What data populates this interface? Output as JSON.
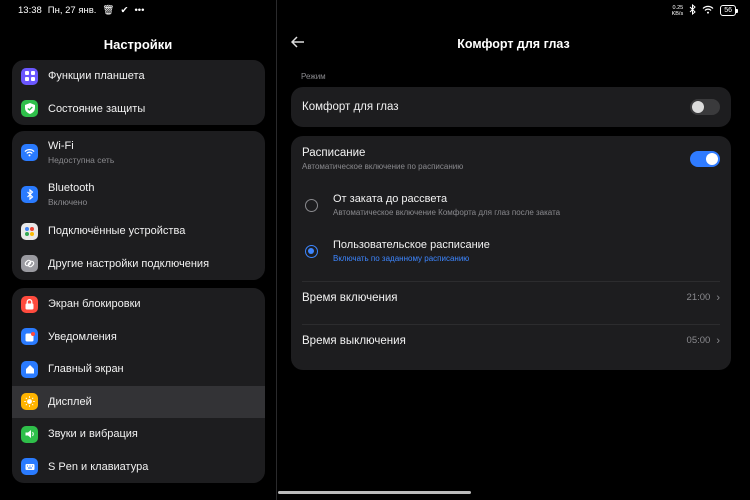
{
  "status_bar": {
    "time": "13:38",
    "date": "Пн, 27 янв.",
    "net_speed": "0.25",
    "net_unit": "KB/s",
    "battery": "56"
  },
  "left": {
    "title": "Настройки",
    "group1": [
      {
        "label": "Функции планшета",
        "icon": "grid-icon",
        "color": "#6b57ff"
      },
      {
        "label": "Состояние защиты",
        "icon": "shield-icon",
        "color": "#2fbf4a"
      }
    ],
    "group2": [
      {
        "label": "Wi-Fi",
        "sub": "Недоступна сеть",
        "icon": "wifi-icon",
        "color": "#2a7bff"
      },
      {
        "label": "Bluetooth",
        "sub": "Включено",
        "icon": "bluetooth-icon",
        "color": "#2a7bff"
      },
      {
        "label": "Подключённые устройства",
        "icon": "devices-icon",
        "color": "#e8e8e8"
      },
      {
        "label": "Другие настройки подключения",
        "icon": "link-icon",
        "color": "#9a9aa0"
      }
    ],
    "group3": [
      {
        "label": "Экран блокировки",
        "icon": "lock-icon",
        "color": "#ff4b3e"
      },
      {
        "label": "Уведомления",
        "icon": "notification-icon",
        "color": "#2a7bff"
      },
      {
        "label": "Главный экран",
        "icon": "home-icon",
        "color": "#2a7bff"
      },
      {
        "label": "Дисплей",
        "icon": "sun-icon",
        "color": "#ffb400"
      },
      {
        "label": "Звуки и вибрация",
        "icon": "sound-icon",
        "color": "#2fbf4a"
      },
      {
        "label": "S Pen и клавиатура",
        "icon": "pen-icon",
        "color": "#2a7bff"
      }
    ]
  },
  "right": {
    "title": "Комфорт для глаз",
    "section": "Режим",
    "eye_comfort": {
      "label": "Комфорт для глаз",
      "enabled": false
    },
    "schedule": {
      "label": "Расписание",
      "sub": "Автоматическое включение по расписанию",
      "enabled": true
    },
    "options": [
      {
        "label": "От заката до рассвета",
        "sub": "Автоматическое включение Комфорта для глаз после заката",
        "selected": false
      },
      {
        "label": "Пользовательское расписание",
        "sub": "Включать по заданному расписанию",
        "selected": true
      }
    ],
    "on_time": {
      "label": "Время включения",
      "value": "21:00"
    },
    "off_time": {
      "label": "Время выключения",
      "value": "05:00"
    }
  }
}
